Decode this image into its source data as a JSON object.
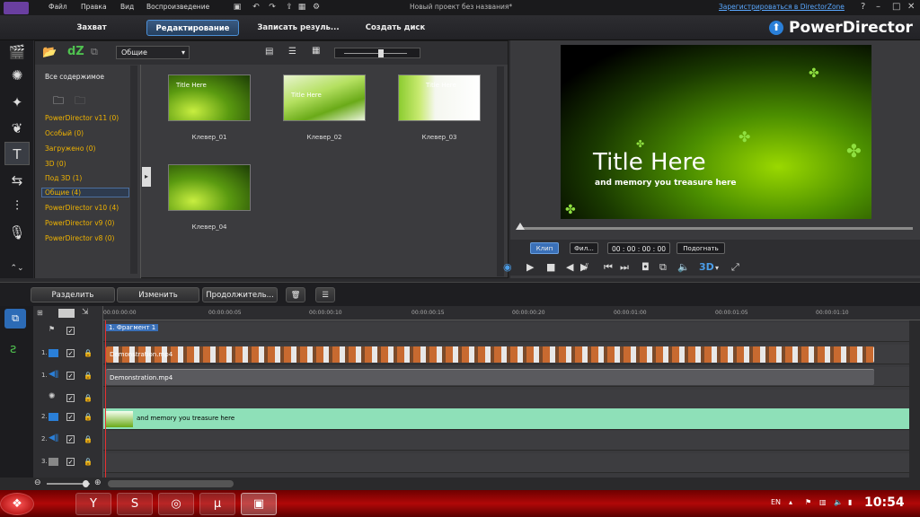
{
  "titlebar": {
    "menu": [
      "Файл",
      "Правка",
      "Вид",
      "Воспроизведение"
    ],
    "project_title": "Новый проект без названия*",
    "register_link": "Зарегистрироваться в DirectorZone",
    "help": "?",
    "minimize": "–",
    "maximize": "□",
    "close": "✕"
  },
  "modes": {
    "capture": "Захват",
    "edit": "Редактирование",
    "produce": "Записать резуль...",
    "disc": "Создать диск",
    "brand": "PowerDirector"
  },
  "library": {
    "dz_label": "dZ",
    "category_dropdown": "Общие",
    "all_content": "Все содержимое",
    "folders": [
      "PowerDirector v11 (0)",
      "Особый (0)",
      "Загружено (0)",
      "3D (0)",
      "Под 3D (1)",
      "Общие (4)",
      "PowerDirector v10 (4)",
      "PowerDirector v9 (0)",
      "PowerDirector v8 (0)"
    ],
    "thumbnails": [
      "Клевер_01",
      "Клевер_02",
      "Клевер_03",
      "Клевер_04"
    ],
    "thumb_title_text": "Title Here"
  },
  "preview": {
    "title_text": "Title Here",
    "subtitle_text": "and memory you treasure here",
    "clip_btn": "Клип",
    "film_btn": "Фил...",
    "timecode": "00 : 00 : 00 : 00",
    "fit_btn": "Подогнать",
    "mode_3d": "3D"
  },
  "timeline_toolbar": {
    "split": "Разделить",
    "edit": "Изменить",
    "continue": "Продолжитель..."
  },
  "timeline": {
    "ruler_ticks": [
      "00:00:00:00",
      "00:00:00:05",
      "00:00:00:10",
      "00:00:00:15",
      "00:00:00:20",
      "00:00:01:00",
      "00:00:01:05",
      "00:00:01:10"
    ],
    "chapter_marker": "1. Фрагмент 1",
    "tracks": [
      {
        "label": "",
        "clip": ""
      },
      {
        "label": "1.",
        "clip": "Demonstration.mp4"
      },
      {
        "label": "1.",
        "clip": "Demonstration.mp4"
      },
      {
        "label": "",
        "clip": ""
      },
      {
        "label": "2.",
        "clip": "and memory you treasure here"
      },
      {
        "label": "2.",
        "clip": ""
      },
      {
        "label": "3.",
        "clip": ""
      }
    ]
  },
  "taskbar": {
    "language": "EN",
    "clock": "10:54"
  }
}
